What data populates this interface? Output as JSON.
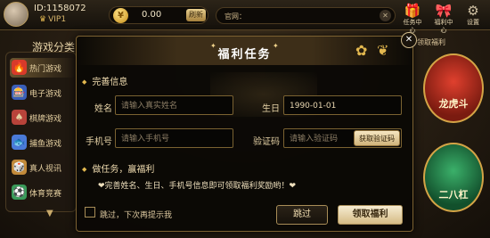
{
  "user": {
    "id": "ID:1158072",
    "vip": "VIP1"
  },
  "coins": {
    "value": "0.00",
    "refresh_label": "刷新"
  },
  "notice": {
    "label": "官网："
  },
  "top_icons": [
    {
      "icon": "gift-icon",
      "glyph": "🎁",
      "label": "任务中心"
    },
    {
      "icon": "gift-box-icon",
      "glyph": "🎀",
      "label": "福利中心"
    },
    {
      "icon": "gear-icon",
      "glyph": "⚙",
      "label": "设置"
    }
  ],
  "categories": {
    "title": "游戏分类",
    "items": [
      {
        "label": "热门游戏",
        "icon": "hot-icon",
        "color": "#d83a2a",
        "glyph": "🔥"
      },
      {
        "label": "电子游戏",
        "icon": "slot-icon",
        "color": "#3a5fb8",
        "glyph": "🎰"
      },
      {
        "label": "棋牌游戏",
        "icon": "cards-icon",
        "color": "#b8433a",
        "glyph": "♠"
      },
      {
        "label": "捕鱼游戏",
        "icon": "fish-icon",
        "color": "#4a7ad8",
        "glyph": "🐟"
      },
      {
        "label": "真人视讯",
        "icon": "live-icon",
        "color": "#c28a3a",
        "glyph": "🎲"
      },
      {
        "label": "体育竞赛",
        "icon": "sports-icon",
        "color": "#3a9a5a",
        "glyph": "⚽"
      }
    ]
  },
  "promos": [
    {
      "label": "龙虎斗"
    },
    {
      "label": "二八杠"
    }
  ],
  "side_text": "领取福利",
  "modal": {
    "title": "福利任务",
    "section1": "完善信息",
    "name_label": "姓名",
    "name_placeholder": "请输入真实姓名",
    "birthday_label": "生日",
    "birthday_value": "1990-01-01",
    "phone_label": "手机号",
    "phone_placeholder": "请输入手机号",
    "code_label": "验证码",
    "code_placeholder": "请输入验证码",
    "code_button": "获取验证码",
    "section2": "做任务，赢福利",
    "promo_text": "❤完善姓名、生日、手机号信息即可领取福利奖励哟！❤",
    "skip_checkbox": "跳过，下次再提示我",
    "skip_button": "跳过",
    "claim_button": "领取福利"
  },
  "colors": {
    "accent": "#e3b84f",
    "border": "#7a6231",
    "claim": "#d5bb85"
  }
}
